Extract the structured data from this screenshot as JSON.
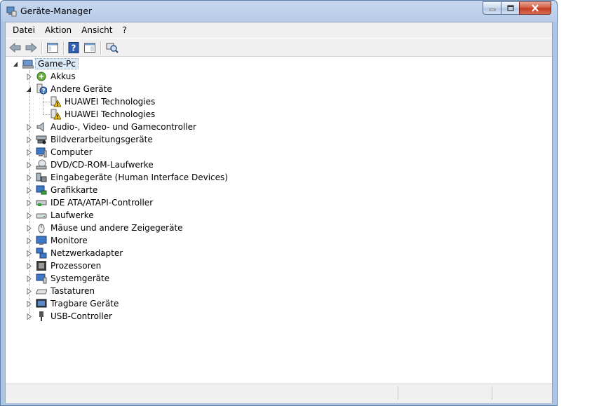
{
  "window": {
    "title": "Geräte-Manager"
  },
  "menu": [
    "Datei",
    "Aktion",
    "Ansicht",
    "?"
  ],
  "toolbar": {
    "buttons": [
      "back-arrow-icon",
      "forward-arrow-icon",
      "console-tree-icon",
      "help-icon",
      "properties-icon",
      "scan-hardware-icon"
    ]
  },
  "tree": {
    "root": "Game-Pc",
    "categories": [
      {
        "label": "Akkus",
        "icon": "battery-icon",
        "expanded": false
      },
      {
        "label": "Andere Geräte",
        "icon": "unknown-device-icon",
        "expanded": true,
        "children": [
          {
            "label": "HUAWEI Technologies",
            "icon": "warning-device-icon"
          },
          {
            "label": "HUAWEI Technologies",
            "icon": "warning-device-icon"
          }
        ]
      },
      {
        "label": "Audio-, Video- und Gamecontroller",
        "icon": "speaker-icon",
        "expanded": false
      },
      {
        "label": "Bildverarbeitungsgeräte",
        "icon": "scanner-icon",
        "expanded": false
      },
      {
        "label": "Computer",
        "icon": "computer-icon",
        "expanded": false
      },
      {
        "label": "DVD/CD-ROM-Laufwerke",
        "icon": "dvd-drive-icon",
        "expanded": false
      },
      {
        "label": "Eingabegeräte (Human Interface Devices)",
        "icon": "hid-icon",
        "expanded": false
      },
      {
        "label": "Grafikkarte",
        "icon": "display-adapter-icon",
        "expanded": false
      },
      {
        "label": "IDE ATA/ATAPI-Controller",
        "icon": "ide-controller-icon",
        "expanded": false
      },
      {
        "label": "Laufwerke",
        "icon": "disk-drive-icon",
        "expanded": false
      },
      {
        "label": "Mäuse und andere Zeigegeräte",
        "icon": "mouse-icon",
        "expanded": false
      },
      {
        "label": "Monitore",
        "icon": "monitor-icon",
        "expanded": false
      },
      {
        "label": "Netzwerkadapter",
        "icon": "network-adapter-icon",
        "expanded": false
      },
      {
        "label": "Prozessoren",
        "icon": "processor-icon",
        "expanded": false
      },
      {
        "label": "Systemgeräte",
        "icon": "system-devices-icon",
        "expanded": false
      },
      {
        "label": "Tastaturen",
        "icon": "keyboard-icon",
        "expanded": false
      },
      {
        "label": "Tragbare Geräte",
        "icon": "portable-device-icon",
        "expanded": false
      },
      {
        "label": "USB-Controller",
        "icon": "usb-icon",
        "expanded": false
      }
    ]
  },
  "colors": {
    "titlebar": "#b7cbe7",
    "selection": "#dce9f7",
    "warning": "#f5c400"
  }
}
